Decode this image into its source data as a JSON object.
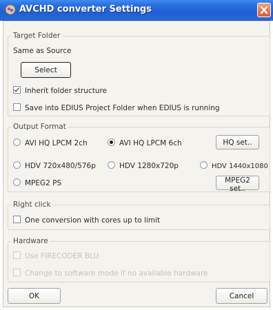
{
  "window": {
    "title": "AVCHD converter Settings"
  },
  "target_folder": {
    "legend": "Target Folder",
    "source_text": "Same as Source",
    "select_label": "Select",
    "inherit_label": "Inherit folder structure",
    "inherit_checked": true,
    "edius_label": "Save into EDIUS Project Folder when EDIUS is running",
    "edius_checked": false
  },
  "output_format": {
    "legend": "Output Format",
    "options": [
      {
        "label": "AVI HQ LPCM 2ch",
        "selected": false
      },
      {
        "label": "AVI HQ LPCM 6ch",
        "selected": true
      },
      {
        "label": "HDV 720x480/576p",
        "selected": false
      },
      {
        "label": "HDV 1280x720p",
        "selected": false
      },
      {
        "label": "HDV 1440x1080",
        "selected": false
      },
      {
        "label": "MPEG2 PS",
        "selected": false
      }
    ],
    "hq_button": "HQ set..",
    "mpeg2_button": "MPEG2 set.."
  },
  "right_click": {
    "legend": "Right click",
    "conversion_label": "One conversion with cores up to limit",
    "conversion_checked": false
  },
  "hardware": {
    "legend": "Hardware",
    "use_label": "Use FIRECODER BLU",
    "change_label": "Change to software mode if no available hardware"
  },
  "footer": {
    "ok_label": "OK",
    "cancel_label": "Cancel"
  },
  "colors": {
    "titlebar": "#2a6fe0",
    "close_button": "#de5b2c",
    "dialog_background": "#f5f3ee"
  }
}
